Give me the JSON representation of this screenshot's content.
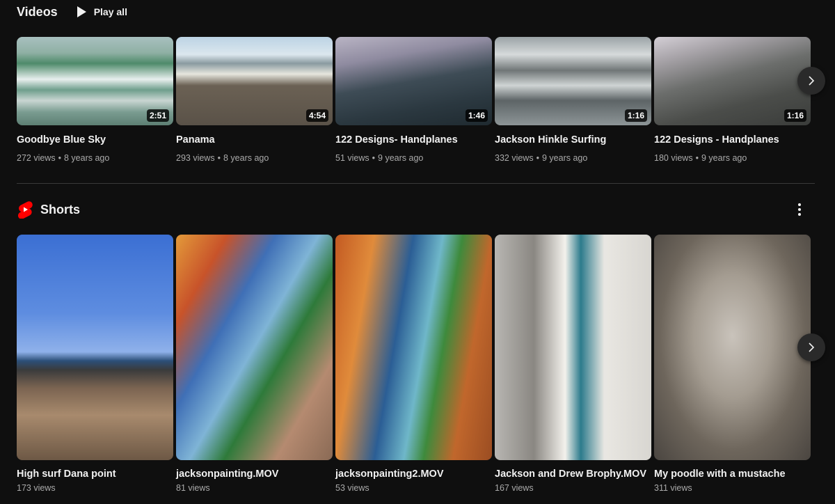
{
  "videos": {
    "title": "Videos",
    "play_all_label": "Play all",
    "items": [
      {
        "title": "Goodbye Blue Sky",
        "duration": "2:51",
        "views": "272 views",
        "age": "8 years ago"
      },
      {
        "title": "Panama",
        "duration": "4:54",
        "views": "293 views",
        "age": "8 years ago"
      },
      {
        "title": "122 Designs- Handplanes",
        "duration": "1:46",
        "views": "51 views",
        "age": "9 years ago"
      },
      {
        "title": "Jackson Hinkle Surfing",
        "duration": "1:16",
        "views": "332 views",
        "age": "9 years ago"
      },
      {
        "title": "122 Designs - Handplanes",
        "duration": "1:16",
        "views": "180 views",
        "age": "9 years ago"
      }
    ]
  },
  "shorts": {
    "title": "Shorts",
    "items": [
      {
        "title": "High surf Dana point",
        "views": "173 views"
      },
      {
        "title": "jacksonpainting.MOV",
        "views": "81 views"
      },
      {
        "title": "jacksonpainting2.MOV",
        "views": "53 views"
      },
      {
        "title": "Jackson and Drew Brophy.MOV",
        "views": "167 views"
      },
      {
        "title": "My poodle with a mustache",
        "views": "311 views"
      }
    ]
  },
  "colors": {
    "background": "#0f0f0f",
    "text_primary": "#f1f1f1",
    "text_secondary": "#aaaaaa",
    "shorts_red": "#ff0000"
  },
  "icons": {
    "play": "play-icon",
    "next": "chevron-right-icon",
    "shorts_logo": "shorts-logo-icon",
    "more": "more-vert-icon"
  }
}
